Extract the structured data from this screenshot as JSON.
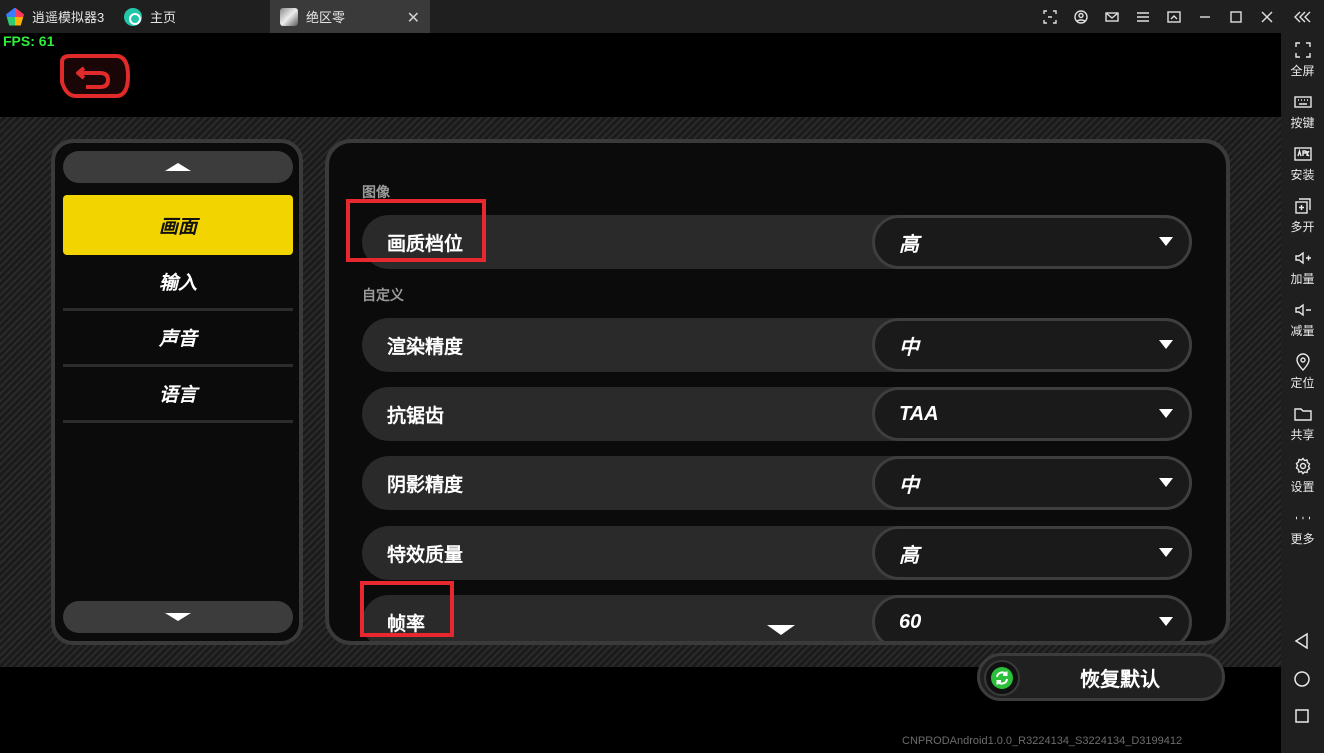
{
  "window": {
    "tabs": [
      {
        "label": "逍遥模拟器3"
      },
      {
        "label": "主页"
      },
      {
        "label": "绝区零"
      }
    ]
  },
  "sidebar": {
    "items": [
      {
        "label": "全屏",
        "icon": "fullscreen-icon"
      },
      {
        "label": "按键",
        "icon": "keyboard-icon"
      },
      {
        "label": "安装",
        "icon": "apk-icon"
      },
      {
        "label": "多开",
        "icon": "multi-instance-icon"
      },
      {
        "label": "加量",
        "icon": "volume-up-icon"
      },
      {
        "label": "减量",
        "icon": "volume-down-icon"
      },
      {
        "label": "定位",
        "icon": "location-icon"
      },
      {
        "label": "共享",
        "icon": "folder-icon"
      },
      {
        "label": "设置",
        "icon": "gear-icon"
      },
      {
        "label": "更多",
        "icon": "more-icon"
      }
    ]
  },
  "game": {
    "fps": "FPS: 61",
    "menu": [
      {
        "label": "画面",
        "active": true
      },
      {
        "label": "输入"
      },
      {
        "label": "声音"
      },
      {
        "label": "语言"
      }
    ],
    "sections": {
      "image": "图像",
      "custom": "自定义"
    },
    "settings": [
      {
        "label": "画质档位",
        "value": "高"
      },
      {
        "label": "渲染精度",
        "value": "中"
      },
      {
        "label": "抗锯齿",
        "value": "TAA"
      },
      {
        "label": "阴影精度",
        "value": "中"
      },
      {
        "label": "特效质量",
        "value": "高"
      },
      {
        "label": "帧率",
        "value": "60"
      }
    ],
    "reset_label": "恢复默认",
    "build": "CNPRODAndroid1.0.0_R3224134_S3224134_D3199412"
  },
  "colors": {
    "accent": "#f2d500",
    "highlight": "#e8282f",
    "fps": "#2ef03a",
    "back": "#e12a2a"
  }
}
